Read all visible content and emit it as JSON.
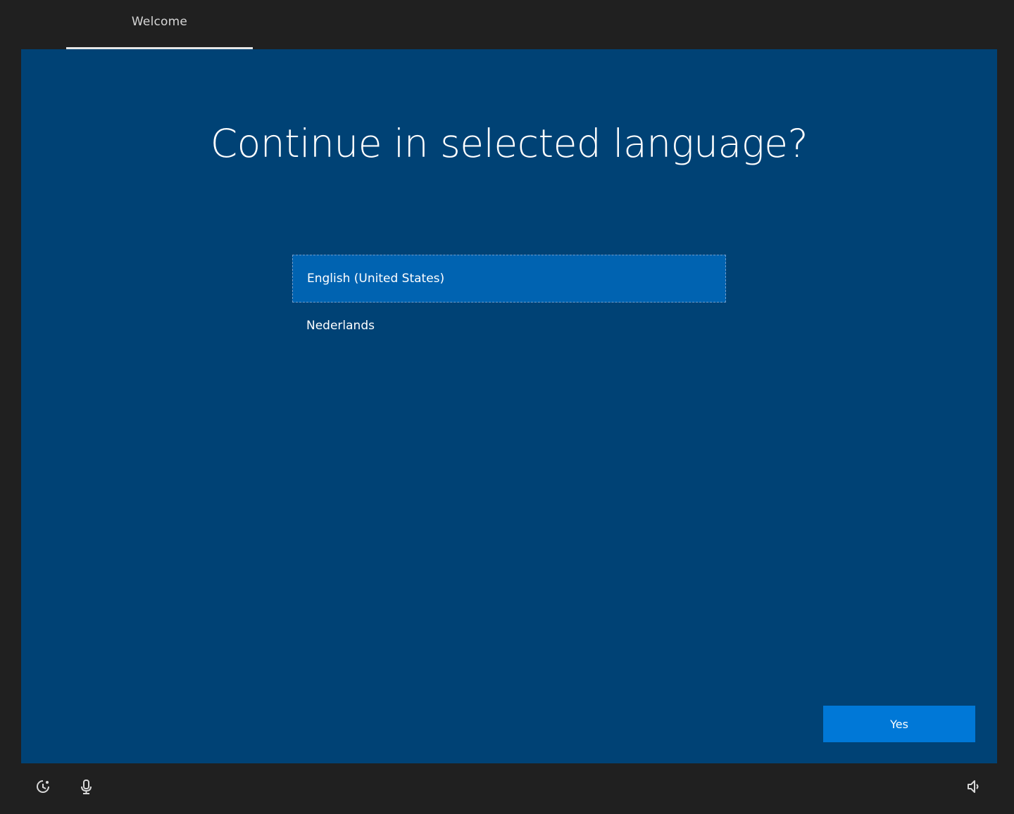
{
  "header": {
    "tabs": [
      {
        "label": "Welcome",
        "active": true
      }
    ]
  },
  "main": {
    "title": "Continue in selected language?",
    "languages": [
      {
        "label": "English (United States)",
        "selected": true
      },
      {
        "label": "Nederlands",
        "selected": false
      }
    ],
    "confirm_label": "Yes"
  },
  "footer": {
    "icons": [
      "ease-of-access-icon",
      "microphone-icon",
      "volume-icon"
    ]
  },
  "colors": {
    "background": "#202020",
    "panel": "#004275",
    "selected_item": "#0063b1",
    "button": "#0078d7",
    "text": "#ffffff"
  }
}
